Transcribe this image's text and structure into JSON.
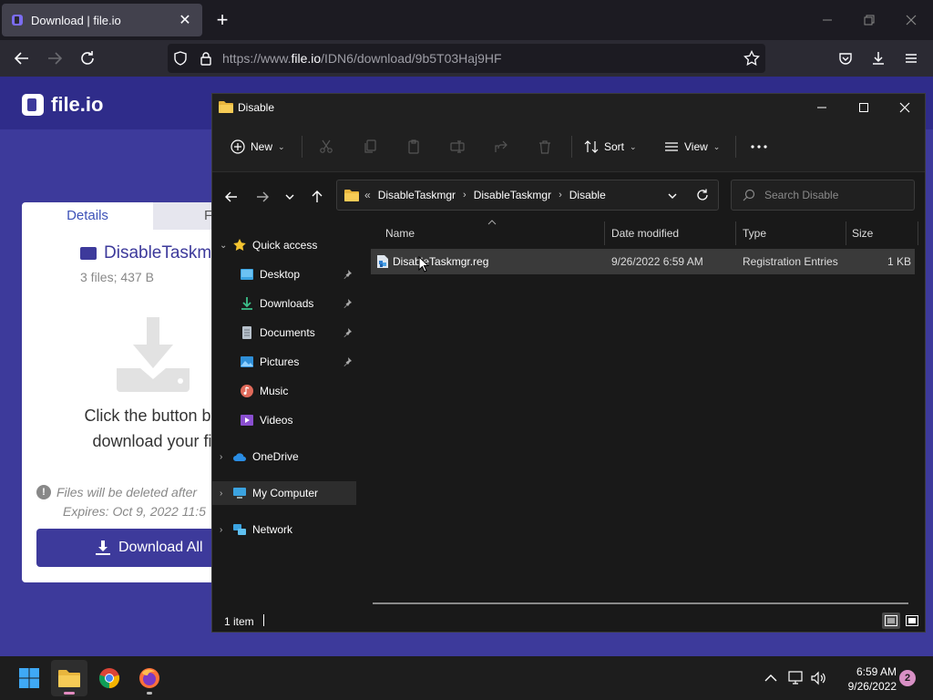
{
  "browser": {
    "tab_title": "Download | file.io",
    "url_prefix": "https://www.",
    "url_domain": "file.io",
    "url_path": "/IDN6/download/9b5T03Haj9HF"
  },
  "website": {
    "logo_text": "file.io",
    "tabs": [
      "Details",
      "F"
    ],
    "file_name": "DisableTaskm",
    "file_meta": "3 files; 437 B",
    "message_line1": "Click the button belo",
    "message_line2": "download your file",
    "warning": "Files will be deleted after",
    "expires": "Expires: Oct 9, 2022 11:5",
    "download_button": "Download All"
  },
  "explorer": {
    "window_title": "Disable",
    "commands": {
      "new": "New",
      "sort": "Sort",
      "view": "View"
    },
    "breadcrumb": [
      "DisableTaskmgr",
      "DisableTaskmgr",
      "Disable"
    ],
    "search_placeholder": "Search Disable",
    "nav": {
      "quick_access": "Quick access",
      "quick_items": [
        "Desktop",
        "Downloads",
        "Documents",
        "Pictures",
        "Music",
        "Videos"
      ],
      "onedrive": "OneDrive",
      "my_computer": "My Computer",
      "network": "Network"
    },
    "columns": [
      "Name",
      "Date modified",
      "Type",
      "Size"
    ],
    "files": [
      {
        "name": "DisableTaskmgr.reg",
        "date_modified": "9/26/2022 6:59 AM",
        "type": "Registration Entries",
        "size": "1 KB"
      }
    ],
    "status_count": "1 item"
  },
  "taskbar": {
    "time": "6:59 AM",
    "date": "9/26/2022",
    "notification_count": "2"
  }
}
